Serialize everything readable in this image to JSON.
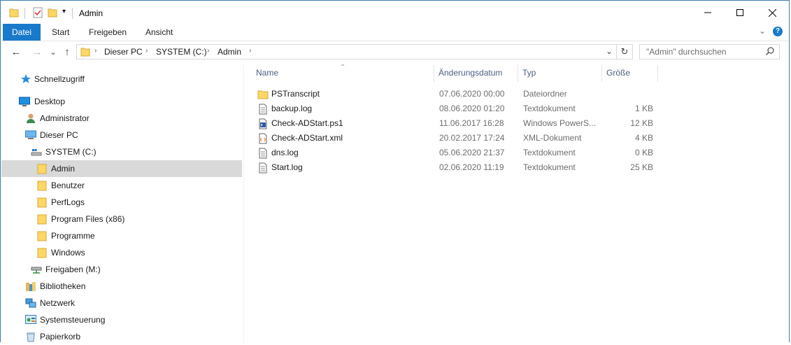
{
  "window": {
    "title": "Admin",
    "controls": {
      "minimize": "—",
      "maximize": "☐",
      "close": "✕"
    }
  },
  "ribbon": {
    "tabs": [
      "Datei",
      "Start",
      "Freigeben",
      "Ansicht"
    ],
    "help": "?",
    "expand": "⌄"
  },
  "nav": {
    "back": "←",
    "forward": "→",
    "recent": "⌄",
    "up": "↑",
    "breadcrumb": [
      "Dieser PC",
      "SYSTEM (C:)",
      "Admin"
    ],
    "dropdown": "⌄",
    "refresh": "↻",
    "search_placeholder": "\"Admin\" durchsuchen"
  },
  "sidebar": {
    "items": [
      {
        "label": "Schnellzugriff",
        "icon": "star-icon"
      },
      {
        "label": "Desktop",
        "icon": "desktop-icon"
      },
      {
        "label": "Administrator",
        "icon": "user-icon"
      },
      {
        "label": "Dieser PC",
        "icon": "computer-icon"
      },
      {
        "label": "SYSTEM (C:)",
        "icon": "drive-icon"
      },
      {
        "label": "Admin",
        "icon": "folder-icon",
        "selected": true
      },
      {
        "label": "Benutzer",
        "icon": "folder-icon"
      },
      {
        "label": "PerfLogs",
        "icon": "folder-icon"
      },
      {
        "label": "Program Files (x86)",
        "icon": "folder-icon"
      },
      {
        "label": "Programme",
        "icon": "folder-icon"
      },
      {
        "label": "Windows",
        "icon": "folder-icon"
      },
      {
        "label": "Freigaben (M:)",
        "icon": "network-drive-icon"
      },
      {
        "label": "Bibliotheken",
        "icon": "libraries-icon"
      },
      {
        "label": "Netzwerk",
        "icon": "network-icon"
      },
      {
        "label": "Systemsteuerung",
        "icon": "control-panel-icon"
      },
      {
        "label": "Papierkorb",
        "icon": "recycle-bin-icon"
      }
    ]
  },
  "files": {
    "columns": [
      "Name",
      "Änderungsdatum",
      "Typ",
      "Größe"
    ],
    "sort_indicator": "⌃",
    "rows": [
      {
        "name": "PSTranscript",
        "date": "07.06.2020 00:00",
        "type": "Dateiordner",
        "size": "",
        "icon": "folder-icon"
      },
      {
        "name": "backup.log",
        "date": "08.06.2020 01:20",
        "type": "Textdokument",
        "size": "1 KB",
        "icon": "text-file-icon"
      },
      {
        "name": "Check-ADStart.ps1",
        "date": "11.06.2017 16:28",
        "type": "Windows PowerS...",
        "size": "12 KB",
        "icon": "powershell-file-icon"
      },
      {
        "name": "Check-ADStart.xml",
        "date": "20.02.2017 17:24",
        "type": "XML-Dokument",
        "size": "4 KB",
        "icon": "xml-file-icon"
      },
      {
        "name": "dns.log",
        "date": "05.06.2020 21:37",
        "type": "Textdokument",
        "size": "0 KB",
        "icon": "text-file-icon"
      },
      {
        "name": "Start.log",
        "date": "02.06.2020 11:19",
        "type": "Textdokument",
        "size": "25 KB",
        "icon": "text-file-icon"
      }
    ]
  },
  "colors": {
    "accent": "#1979ca",
    "selection": "#d9d9d9",
    "folder": "#ffd766"
  }
}
